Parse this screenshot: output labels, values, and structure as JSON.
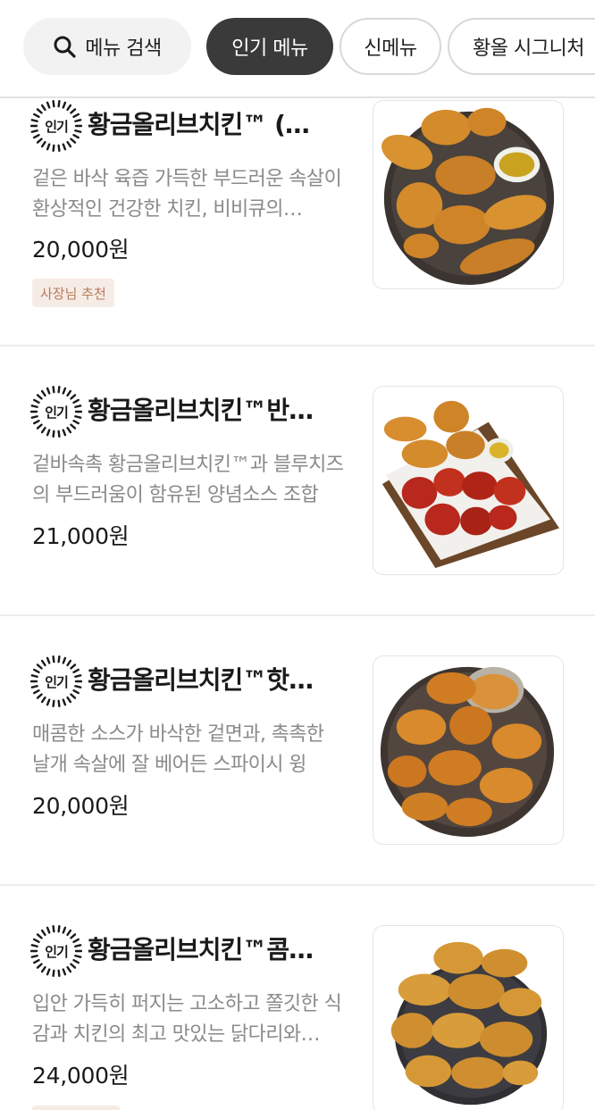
{
  "categories": {
    "search_label": "메뉴 검색",
    "chips": [
      {
        "label": "인기 메뉴",
        "active": true
      },
      {
        "label": "신메뉴",
        "active": false
      },
      {
        "label": "황올 시그니처",
        "active": false
      }
    ]
  },
  "badge_label": "인기",
  "menu_items": [
    {
      "name": "황금올리브치킨™ (…",
      "description": "겉은 바삭 육즙 가득한 부드러운 속살이 환상적인 건강한 치킨, 비비큐의…",
      "price": "20,000원",
      "tag": "사장님 추천",
      "image": "fried-chicken-plate-with-sauce"
    },
    {
      "name": "황금올리브치킨™반…",
      "description": "겉바속촉 황금올리브치킨™과 블루치즈의 부드러움이 함유된 양념소스 조합",
      "price": "21,000원",
      "image": "half-and-half-chicken-on-board"
    },
    {
      "name": "황금올리브치킨™핫…",
      "description": "매콤한 소스가 바삭한 겉면과, 촉촉한 날개 속살에 잘 베어든 스파이시 윙",
      "price": "20,000원",
      "image": "hot-wings-plate-with-sauce"
    },
    {
      "name": "황금올리브치킨™콤…",
      "description": "입안 가득히 퍼지는 고소하고 쫄깃한 식감과 치킨의 최고 맛있는 닭다리와…",
      "price": "24,000원",
      "image": "drumstick-combo-plate"
    }
  ],
  "colors": {
    "active_chip": "#3a3a3a",
    "tag_bg": "#f6ece6",
    "tag_text": "#b87a5a",
    "chicken": "#d68a2c",
    "spicy": "#b8281c"
  }
}
